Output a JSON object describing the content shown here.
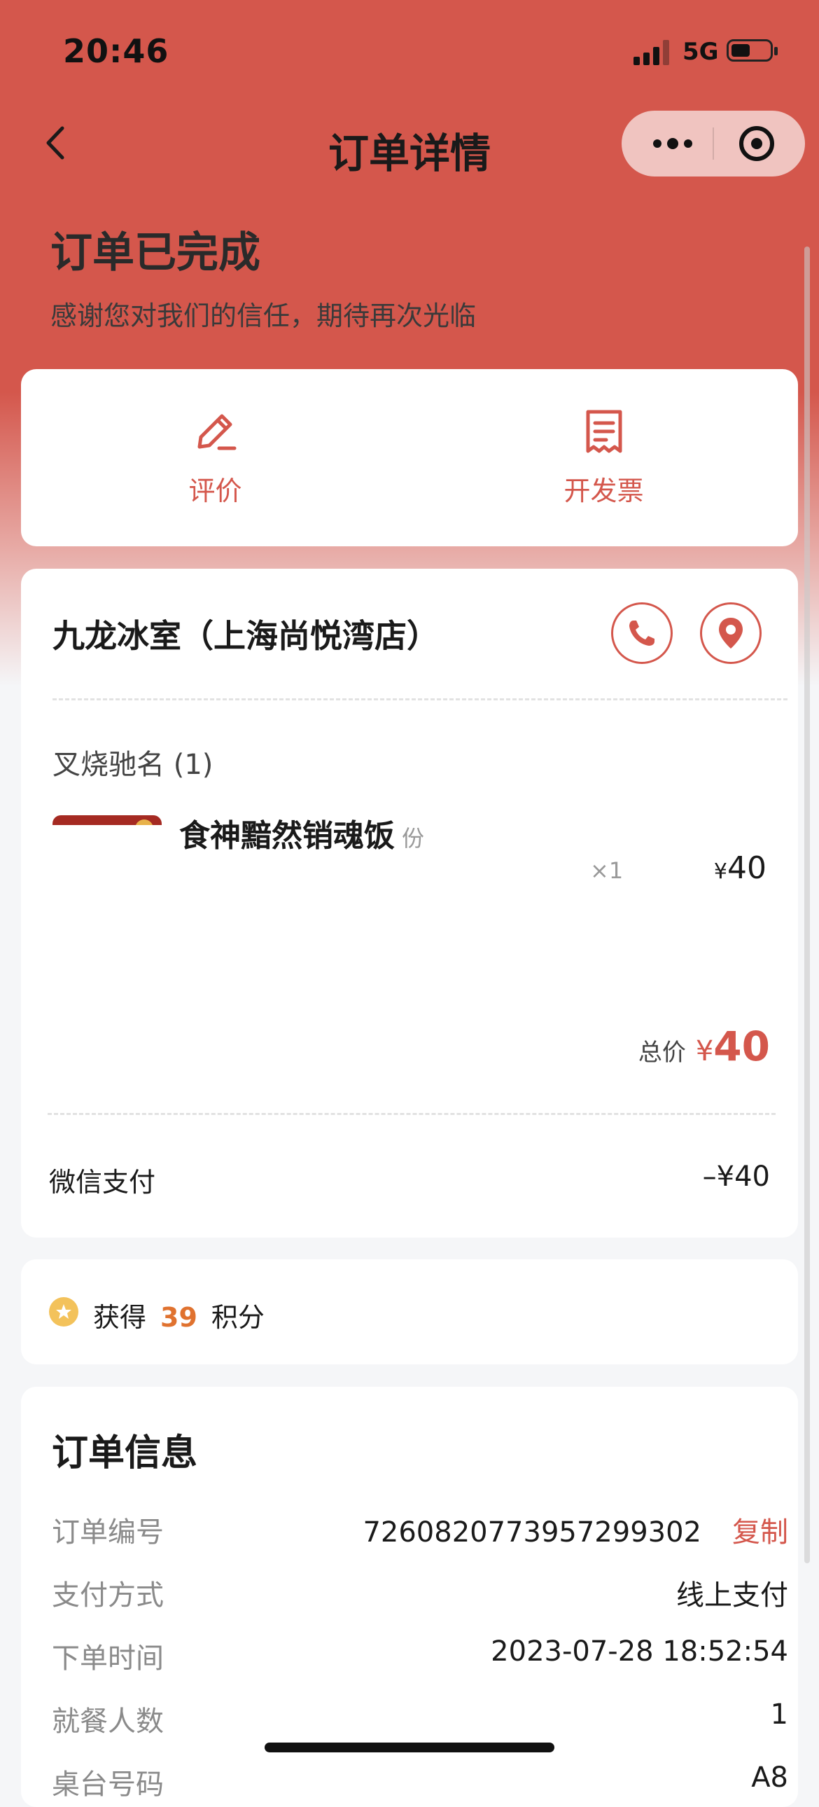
{
  "status_bar": {
    "time": "20:46",
    "network": "5G",
    "icons": [
      "signal-icon",
      "battery-icon"
    ]
  },
  "nav": {
    "title": "订单详情",
    "icons": [
      "back-icon",
      "more-icon",
      "target-icon"
    ]
  },
  "order": {
    "status": "订单已完成",
    "subtitle": "感谢您对我们的信任，期待再次光临"
  },
  "actions": [
    {
      "label": "评价",
      "icon": "edit-icon"
    },
    {
      "label": "开发票",
      "icon": "receipt-icon"
    }
  ],
  "store": {
    "name": "九龙冰室（上海尚悦湾店）",
    "icons": [
      "phone-icon",
      "location-icon"
    ],
    "group_title": "叉烧驰名 (1)",
    "item": {
      "name": "食神黯然销魂饭",
      "unit": "份",
      "qty": "×1",
      "currency": "¥",
      "price": "40"
    },
    "total": {
      "label": "总价",
      "currency": "¥",
      "value": "40"
    },
    "payment": {
      "method": "微信支付",
      "amount": "–¥40"
    }
  },
  "points": {
    "prefix": "获得",
    "value": "39",
    "suffix": "积分",
    "icon": "star-coin-icon"
  },
  "info": {
    "title": "订单信息",
    "rows": [
      {
        "key": "订单编号",
        "value": "7260820773957299302",
        "action": "复制"
      },
      {
        "key": "支付方式",
        "value": "线上支付"
      },
      {
        "key": "下单时间",
        "value": "2023-07-28 18:52:54"
      },
      {
        "key": "就餐人数",
        "value": "1"
      },
      {
        "key": "桌台号码",
        "value": "A8"
      }
    ]
  },
  "colors": {
    "accent": "#d4574c",
    "points": "#e0722f",
    "background": "#f5f6f8"
  }
}
